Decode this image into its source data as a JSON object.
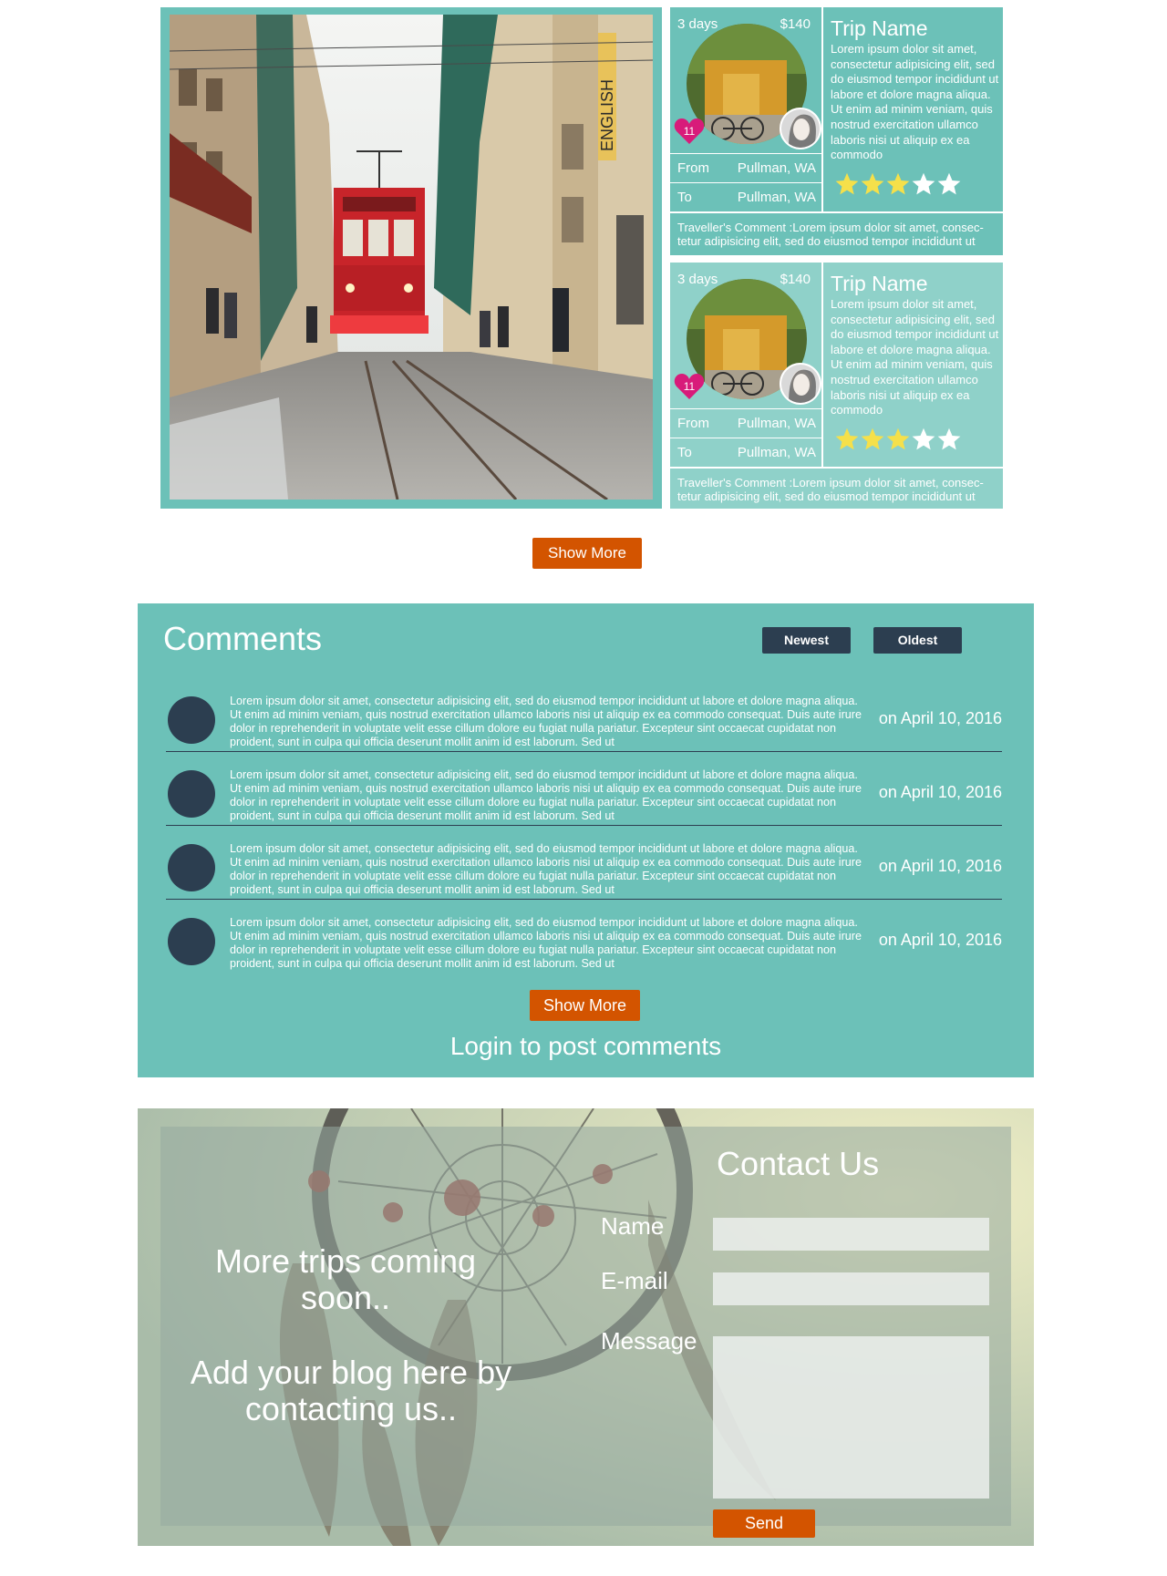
{
  "colors": {
    "teal": "#6cc1b8",
    "teal_light": "#8fd1c9",
    "orange": "#d35400",
    "navy": "#2c3e50",
    "star_yellow": "#f5e04a",
    "heart_pink": "#d81b7a"
  },
  "trips": {
    "hero_image": "tram-street-photo",
    "show_more": "Show More",
    "cards": [
      {
        "days": "3 days",
        "price": "$140",
        "likes": "11",
        "title": "Trip Name",
        "description": "Lorem ipsum dolor sit amet, consectetur adipisicing elit, sed do eiusmod tempor incididunt ut labore et dolore magna aliqua. Ut enim ad minim veniam, quis nostrud exercitation ullamco laboris nisi ut aliquip ex ea commodo",
        "from_label": "From",
        "from_value": "Pullman, WA",
        "to_label": "To",
        "to_value": "Pullman, WA",
        "rating": 3,
        "rating_max": 5,
        "comment": "Traveller's Comment :Lorem ipsum dolor sit amet, consec-tetur adipisicing elit, sed do eiusmod tempor incididunt ut"
      },
      {
        "days": "3 days",
        "price": "$140",
        "likes": "11",
        "title": "Trip Name",
        "description": "Lorem ipsum dolor sit amet, consectetur adipisicing elit, sed do eiusmod tempor incididunt ut labore et dolore magna aliqua. Ut enim ad minim veniam, quis nostrud exercitation ullamco laboris nisi ut aliquip ex ea commodo",
        "from_label": "From",
        "from_value": "Pullman, WA",
        "to_label": "To",
        "to_value": "Pullman, WA",
        "rating": 3,
        "rating_max": 5,
        "comment": "Traveller's Comment :Lorem ipsum dolor sit amet, consec-tetur adipisicing elit, sed do eiusmod tempor incididunt ut"
      }
    ]
  },
  "comments": {
    "title": "Comments",
    "sort_newest": "Newest",
    "sort_oldest": "Oldest",
    "items": [
      {
        "text": "Lorem ipsum dolor sit amet, consectetur adipisicing elit, sed do eiusmod tempor incididunt ut labore et dolore magna aliqua. Ut enim ad minim veniam, quis nostrud exercitation ullamco laboris nisi ut aliquip ex ea commodo consequat. Duis aute irure dolor in reprehenderit in voluptate velit esse cillum dolore eu fugiat nulla pariatur. Excepteur sint occaecat cupidatat non proident, sunt in culpa qui officia deserunt mollit anim id est laborum. Sed ut",
        "date": "on April 10, 2016"
      },
      {
        "text": "Lorem ipsum dolor sit amet, consectetur adipisicing elit, sed do eiusmod tempor incididunt ut labore et dolore magna aliqua. Ut enim ad minim veniam, quis nostrud exercitation ullamco laboris nisi ut aliquip ex ea commodo consequat. Duis aute irure dolor in reprehenderit in voluptate velit esse cillum dolore eu fugiat nulla pariatur. Excepteur sint occaecat cupidatat non proident, sunt in culpa qui officia deserunt mollit anim id est laborum. Sed ut",
        "date": "on April 10, 2016"
      },
      {
        "text": "Lorem ipsum dolor sit amet, consectetur adipisicing elit, sed do eiusmod tempor incididunt ut labore et dolore magna aliqua. Ut enim ad minim veniam, quis nostrud exercitation ullamco laboris nisi ut aliquip ex ea commodo consequat. Duis aute irure dolor in reprehenderit in voluptate velit esse cillum dolore eu fugiat nulla pariatur. Excepteur sint occaecat cupidatat non proident, sunt in culpa qui officia deserunt mollit anim id est laborum. Sed ut",
        "date": "on April 10, 2016"
      },
      {
        "text": "Lorem ipsum dolor sit amet, consectetur adipisicing elit, sed do eiusmod tempor incididunt ut labore et dolore magna aliqua. Ut enim ad minim veniam, quis nostrud exercitation ullamco laboris nisi ut aliquip ex ea commodo consequat. Duis aute irure dolor in reprehenderit in voluptate velit esse cillum dolore eu fugiat nulla pariatur. Excepteur sint occaecat cupidatat non proident, sunt in culpa qui officia deserunt mollit anim id est laborum. Sed ut",
        "date": "on April 10, 2016"
      }
    ],
    "show_more": "Show More",
    "login_prompt": "Login to post comments"
  },
  "contact": {
    "background_image": "dreamcatcher-photo",
    "promo_line_1": "More trips coming soon..",
    "promo_line_2": "Add your blog here by contacting us..",
    "title": "Contact Us",
    "name_label": "Name",
    "email_label": "E-mail",
    "message_label": "Message",
    "name_value": "",
    "email_value": "",
    "message_value": "",
    "send_label": "Send"
  }
}
